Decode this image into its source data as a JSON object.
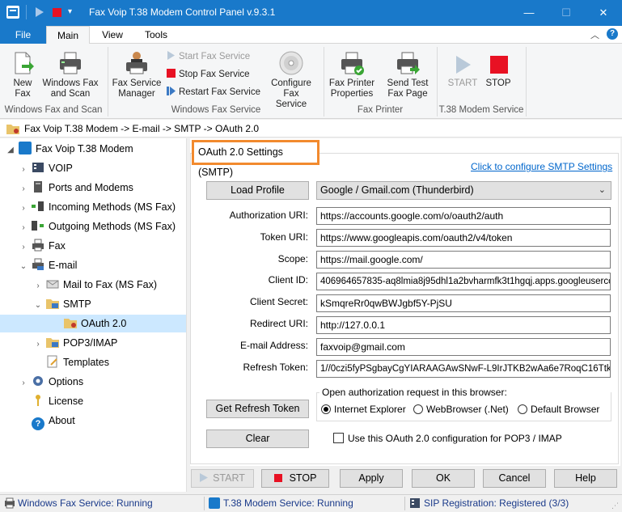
{
  "window": {
    "title": "Fax Voip T.38 Modem Control Panel v.9.3.1",
    "minimize": "—",
    "maximize": "☐",
    "close": "✕"
  },
  "ribbon_tabs": [
    "File",
    "Main",
    "View",
    "Tools"
  ],
  "ribbon": {
    "new_fax": "New Fax",
    "windows_fax_scan": "Windows Fax and Scan",
    "group_wfs": "Windows Fax and Scan",
    "fax_service_manager": "Fax Service Manager",
    "start_fax_service": "Start Fax Service",
    "stop_fax_service": "Stop Fax Service",
    "restart_fax_service": "Restart Fax Service",
    "configure_fax_service": "Configure Fax Service",
    "group_service": "Windows Fax Service",
    "fax_printer_properties": "Fax Printer Properties",
    "send_test_fax_page": "Send Test Fax Page",
    "group_printer": "Fax Printer",
    "start": "START",
    "stop": "STOP",
    "group_modem": "T.38 Modem Service"
  },
  "breadcrumb": "Fax Voip T.38 Modem -> E-mail -> SMTP -> OAuth 2.0",
  "tree": {
    "root": "Fax Voip T.38 Modem",
    "voip": "VOIP",
    "ports": "Ports and Modems",
    "incoming": "Incoming Methods (MS Fax)",
    "outgoing": "Outgoing Methods (MS Fax)",
    "fax": "Fax",
    "email": "E-mail",
    "mail_to_fax": "Mail to Fax (MS Fax)",
    "smtp": "SMTP",
    "oauth": "OAuth 2.0",
    "pop3": "POP3/IMAP",
    "templates": "Templates",
    "options": "Options",
    "license": "License",
    "about": "About"
  },
  "form": {
    "section_title": "OAuth 2.0 Settings (SMTP)",
    "configure_link": "Click to configure SMTP Settings",
    "load_profile": "Load Profile",
    "profile_value": "Google / Gmail.com (Thunderbird)",
    "labels": {
      "auth_uri": "Authorization URI:",
      "token_uri": "Token URI:",
      "scope": "Scope:",
      "client_id": "Client ID:",
      "client_secret": "Client Secret:",
      "redirect_uri": "Redirect URI:",
      "email": "E-mail Address:",
      "refresh_token": "Refresh Token:"
    },
    "values": {
      "auth_uri": "https://accounts.google.com/o/oauth2/auth",
      "token_uri": "https://www.googleapis.com/oauth2/v4/token",
      "scope": "https://mail.google.com/",
      "client_id": "406964657835-aq8lmia8j95dhl1a2bvharmfk3t1hgqj.apps.googleuserco",
      "client_secret": "kSmqreRr0qwBWJgbf5Y-PjSU",
      "redirect_uri": "http://127.0.0.1",
      "email": "faxvoip@gmail.com",
      "refresh_token": "1//0czi5fyPSgbayCgYIARAAGAwSNwF-L9IrJTKB2wAa6e7RoqC16Ttk-"
    },
    "get_refresh_token": "Get Refresh Token",
    "browser_group": "Open authorization request in this browser:",
    "browser_options": [
      "Internet Explorer",
      "WebBrowser (.Net)",
      "Default Browser"
    ],
    "browser_selected": "Internet Explorer",
    "clear": "Clear",
    "pop3_checkbox": "Use this OAuth 2.0 configuration for POP3 / IMAP",
    "pop3_checked": false
  },
  "bottom_buttons": {
    "start": "START",
    "stop": "STOP",
    "apply": "Apply",
    "ok": "OK",
    "cancel": "Cancel",
    "help": "Help"
  },
  "status": {
    "fax_service": "Windows Fax Service: Running",
    "modem_service": "T.38 Modem Service: Running",
    "sip": "SIP Registration: Registered (3/3)"
  },
  "colors": {
    "accent": "#1979ca",
    "highlight": "#f28a2e",
    "selection": "#cce8ff",
    "link": "#0066cc",
    "stop_red": "#e81123"
  }
}
